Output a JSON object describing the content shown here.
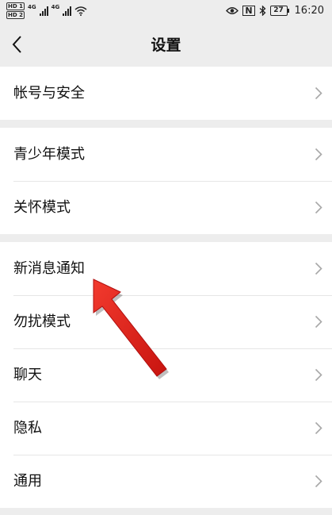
{
  "status_bar": {
    "hd1": "HD 1",
    "hd2": "HD 2",
    "net1": "4G",
    "net2": "4G",
    "nfc": "N",
    "battery": "27",
    "time": "16:20"
  },
  "header": {
    "title": "设置"
  },
  "groups": [
    {
      "items": [
        {
          "label": "帐号与安全"
        }
      ]
    },
    {
      "items": [
        {
          "label": "青少年模式"
        },
        {
          "label": "关怀模式"
        }
      ]
    },
    {
      "items": [
        {
          "label": "新消息通知"
        },
        {
          "label": "勿扰模式"
        },
        {
          "label": "聊天"
        },
        {
          "label": "隐私"
        },
        {
          "label": "通用"
        }
      ]
    }
  ],
  "colors": {
    "background": "#ededed",
    "row_background": "#ffffff",
    "annotation_arrow": "#e8201a"
  },
  "icons": {
    "back": "back-arrow-icon",
    "row": "chevron-right-icon",
    "eye": "eye-icon",
    "bluetooth": "bluetooth-icon",
    "wifi": "wifi-icon"
  }
}
